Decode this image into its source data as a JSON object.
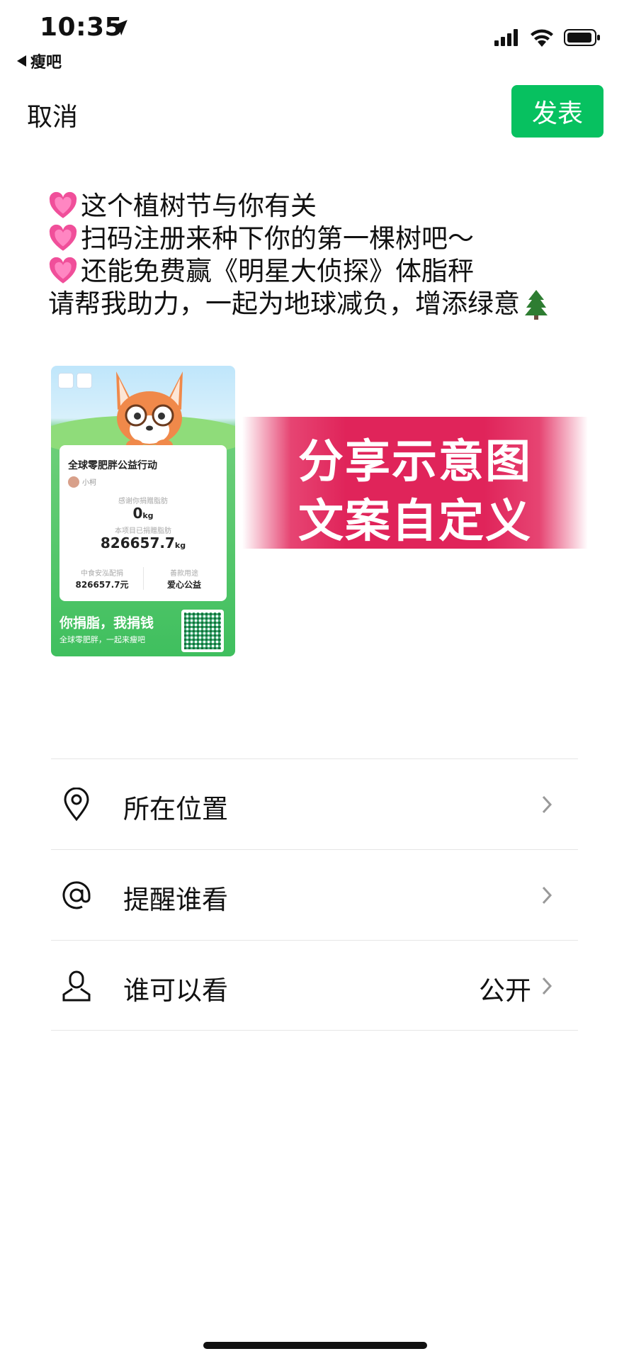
{
  "status_bar": {
    "time": "10:35",
    "back_app": "瘦吧"
  },
  "nav": {
    "cancel_label": "取消",
    "publish_label": "发表"
  },
  "post": {
    "lines": [
      "这个植树节与你有关",
      "扫码注册来种下你的第一棵树吧～",
      "还能免费赢《明星大侦探》体脂秤",
      "请帮我助力，一起为地球减负，增添绿意"
    ],
    "line_icons": [
      "heart-icon",
      "heart-icon",
      "heart-icon",
      "tree-icon"
    ]
  },
  "card": {
    "title": "全球零肥胖公益行动",
    "user": "小柯",
    "label_thanks": "感谢你捐赠脂肪",
    "value_thanks": "0",
    "unit": "kg",
    "label_total": "本项目已捐赠脂肪",
    "value_total": "826657.7",
    "label_donation": "中食安泓配捐",
    "value_donation": "826657.7元",
    "label_usage": "善款用途",
    "value_usage": "爱心公益",
    "slogan": "你捐脂，我捐钱",
    "subslogan": "全球零肥胖，一起来瘦吧"
  },
  "banner": {
    "line1": "分享示意图",
    "line2": "文案自定义"
  },
  "options": [
    {
      "label": "所在位置",
      "value": "",
      "icon": "location-pin-icon"
    },
    {
      "label": "提醒谁看",
      "value": "",
      "icon": "at-sign-icon"
    },
    {
      "label": "谁可以看",
      "value": "公开",
      "icon": "person-icon"
    }
  ],
  "colors": {
    "accent": "#07c160",
    "banner": "#e0245a",
    "card_green": "#3fbf5e"
  }
}
